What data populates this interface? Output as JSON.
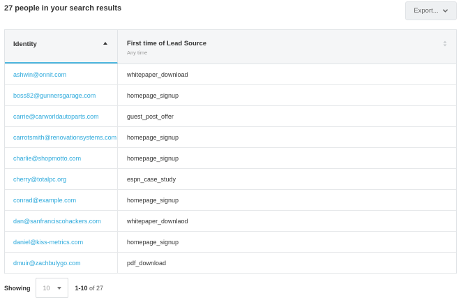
{
  "header": {
    "results_text": "27 people in your search results",
    "export_label": "Export..."
  },
  "table": {
    "columns": [
      {
        "label": "Identity",
        "sort": "ascending"
      },
      {
        "label": "First time of Lead Source",
        "sublabel": "Any time",
        "sort": "none"
      }
    ],
    "rows": [
      {
        "identity": "ashwin@onnit.com",
        "lead_source": "whitepaper_download"
      },
      {
        "identity": "boss82@gunnersgarage.com",
        "lead_source": "homepage_signup"
      },
      {
        "identity": "carrie@carworldautoparts.com",
        "lead_source": "guest_post_offer"
      },
      {
        "identity": "carrotsmith@renovationsystems.com",
        "lead_source": "homepage_signup"
      },
      {
        "identity": "charlie@shopmotto.com",
        "lead_source": "homepage_signup"
      },
      {
        "identity": "cherry@totalpc.org",
        "lead_source": "espn_case_study"
      },
      {
        "identity": "conrad@example.com",
        "lead_source": "homepage_signup"
      },
      {
        "identity": "dan@sanfranciscohackers.com",
        "lead_source": "whitepaper_downlaod"
      },
      {
        "identity": "daniel@kiss-metrics.com",
        "lead_source": "homepage_signup"
      },
      {
        "identity": "dmuir@zachbulygo.com",
        "lead_source": "pdf_download"
      }
    ]
  },
  "footer": {
    "showing_label": "Showing",
    "per_page_value": "10",
    "range": "1-10",
    "of_text": "of 27"
  },
  "colors": {
    "link": "#2eaadc",
    "active_sort_underline": "#4fb8e0"
  }
}
